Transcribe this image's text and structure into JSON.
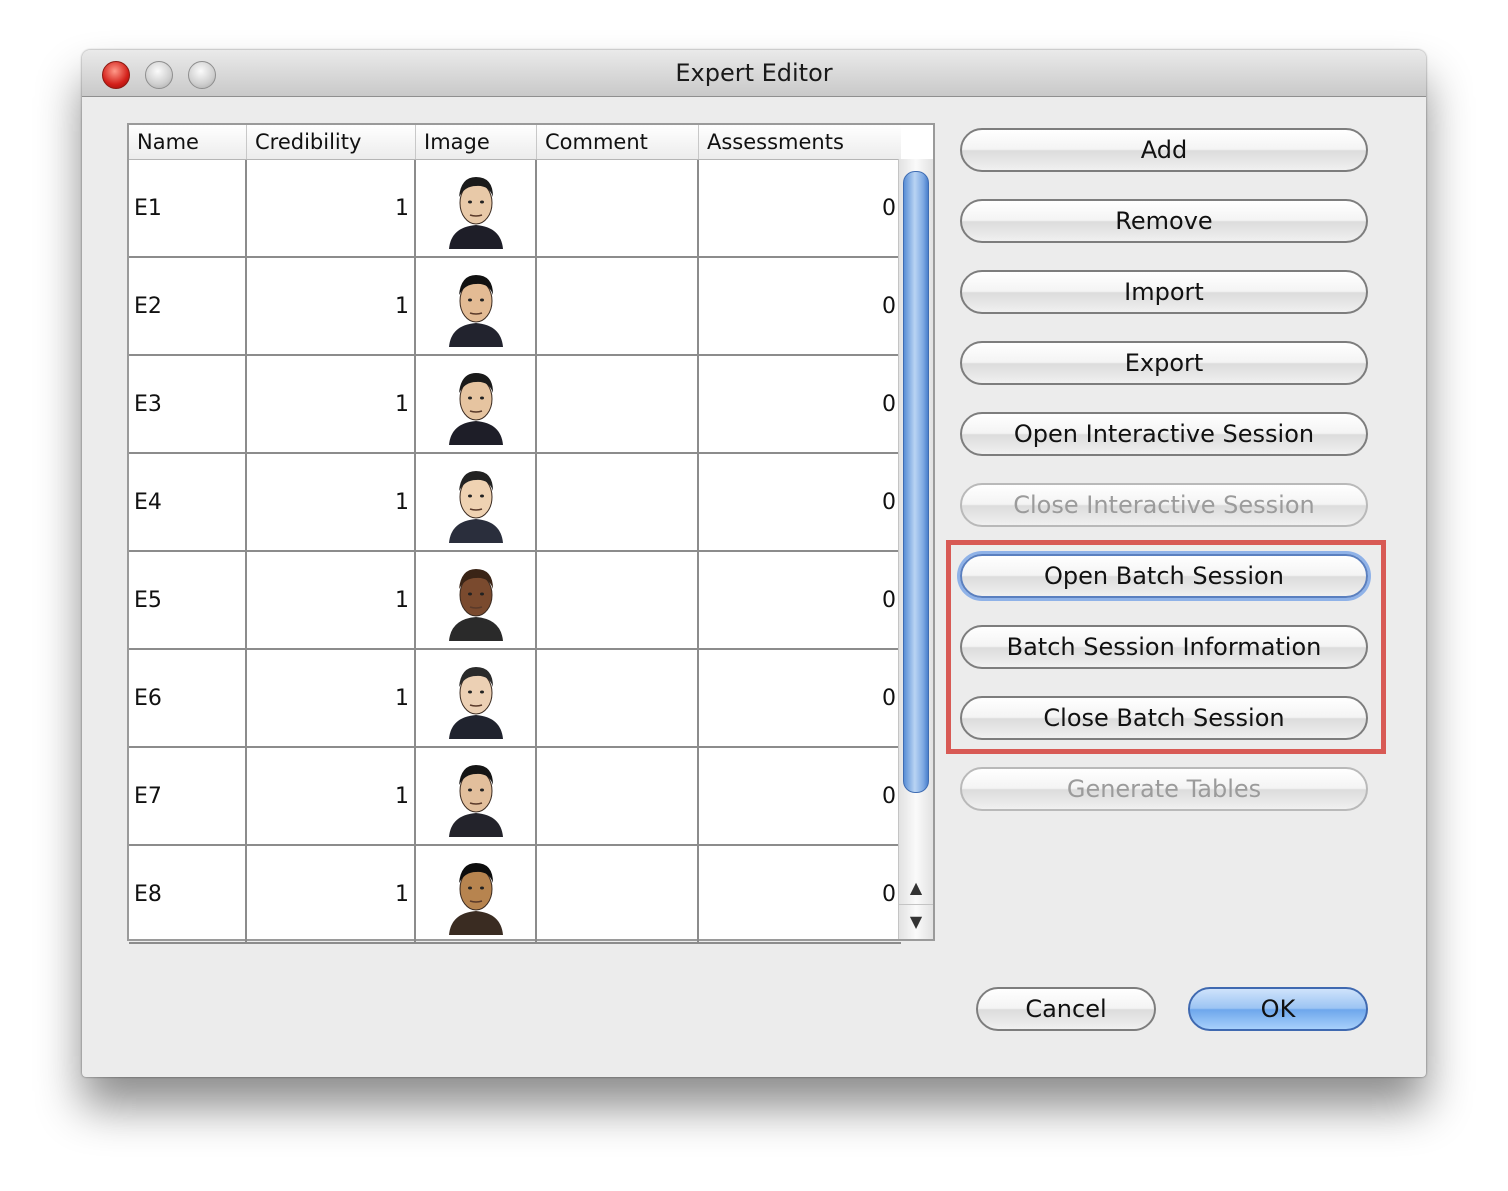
{
  "window": {
    "title": "Expert Editor"
  },
  "table": {
    "columns": [
      "Name",
      "Credibility",
      "Image",
      "Comment",
      "Assessments"
    ],
    "rows": [
      {
        "name": "E1",
        "credibility": "1",
        "image": "expert-portrait-1",
        "comment": "",
        "assessments": "0"
      },
      {
        "name": "E2",
        "credibility": "1",
        "image": "expert-portrait-2",
        "comment": "",
        "assessments": "0"
      },
      {
        "name": "E3",
        "credibility": "1",
        "image": "expert-portrait-3",
        "comment": "",
        "assessments": "0"
      },
      {
        "name": "E4",
        "credibility": "1",
        "image": "expert-portrait-4",
        "comment": "",
        "assessments": "0"
      },
      {
        "name": "E5",
        "credibility": "1",
        "image": "expert-portrait-5",
        "comment": "",
        "assessments": "0"
      },
      {
        "name": "E6",
        "credibility": "1",
        "image": "expert-portrait-6",
        "comment": "",
        "assessments": "0"
      },
      {
        "name": "E7",
        "credibility": "1",
        "image": "expert-portrait-7",
        "comment": "",
        "assessments": "0"
      },
      {
        "name": "E8",
        "credibility": "1",
        "image": "expert-portrait-8",
        "comment": "",
        "assessments": "0"
      }
    ]
  },
  "buttons": {
    "add": "Add",
    "remove": "Remove",
    "import": "Import",
    "export": "Export",
    "open_interactive": "Open Interactive Session",
    "close_interactive": "Close Interactive Session",
    "open_batch": "Open Batch Session",
    "batch_info": "Batch Session Information",
    "close_batch": "Close Batch Session",
    "generate_tables": "Generate Tables",
    "cancel": "Cancel",
    "ok": "OK"
  },
  "colors": {
    "highlight_box": "#d85a55",
    "default_button": "#6ea7ec",
    "scroll_thumb": "#7ea9e3"
  }
}
